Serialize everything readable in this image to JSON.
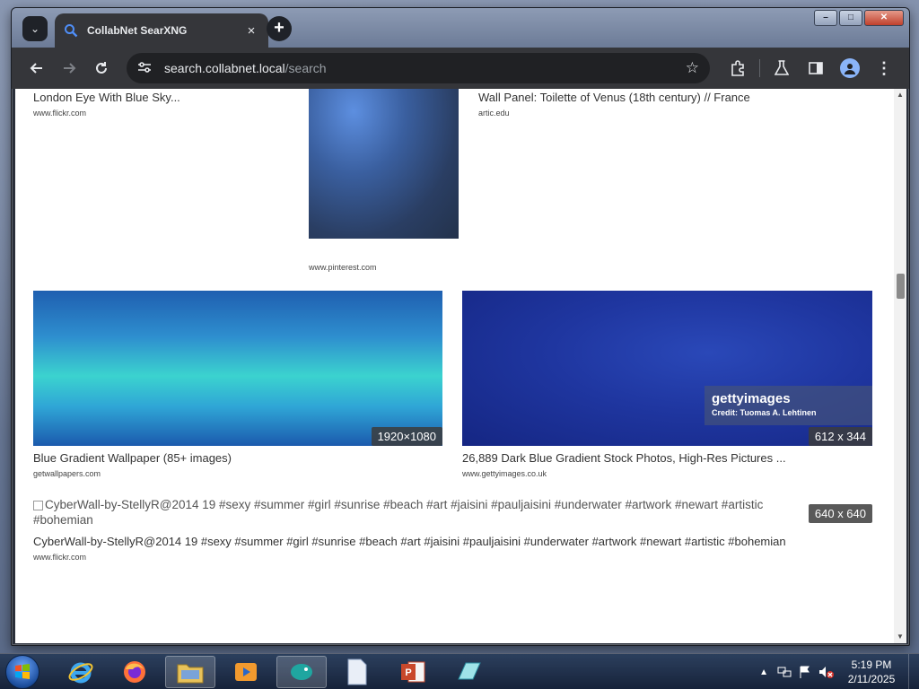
{
  "browser": {
    "tab_title": "CollabNet SearXNG",
    "tab_close": "×",
    "new_tab": "+",
    "url_host": "search.collabnet.local",
    "url_path": "/search"
  },
  "window_controls": {
    "minimize": "–",
    "maximize": "□",
    "close": "✕"
  },
  "results": [
    {
      "title": "London Eye With Blue Sky...",
      "host": "www.flickr.com"
    },
    {
      "title": "",
      "host": "www.pinterest.com"
    },
    {
      "title": "Wall Panel: Toilette of Venus (18th century) // France",
      "host": "artic.edu"
    },
    {
      "title": "Blue Gradient Wallpaper (85+ images)",
      "host": "getwallpapers.com",
      "size": "1920×1080"
    },
    {
      "title": "26,889 Dark Blue Gradient Stock Photos, High-Res Pictures ...",
      "host": "www.gettyimages.co.uk",
      "size": "612 x 344",
      "watermark_brand": "gettyimages",
      "watermark_credit": "Credit: Tuomas A. Lehtinen"
    },
    {
      "alt": "CyberWall-by-StellyR@2014 19 #sexy #summer #girl #sunrise #beach #art #jaisini #pauljaisini #underwater #artwork #newart #artistic #bohemian",
      "title": "CyberWall-by-StellyR@2014 19 #sexy #summer #girl #sunrise #beach #art #jaisini #pauljaisini #underwater #artwork #newart #artistic #bohemian",
      "host": "www.flickr.com",
      "size": "640 x 640"
    }
  ],
  "taskbar": {
    "time": "5:19 PM",
    "date": "2/11/2025",
    "apps": [
      "internet-explorer",
      "firefox",
      "file-explorer",
      "media-player",
      "chrome-app",
      "notepad",
      "powerpoint",
      "note-app"
    ]
  },
  "colors": {
    "accent": "#8ab4f8",
    "chrome_dark": "#35363a"
  }
}
